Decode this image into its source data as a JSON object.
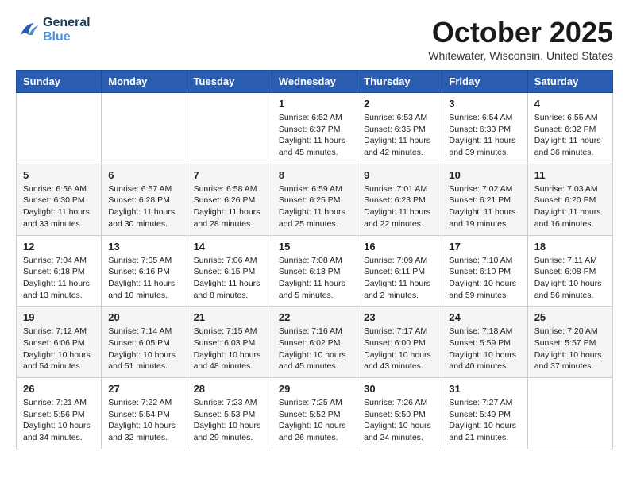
{
  "header": {
    "logo_line1": "General",
    "logo_line2": "Blue",
    "month": "October 2025",
    "location": "Whitewater, Wisconsin, United States"
  },
  "weekdays": [
    "Sunday",
    "Monday",
    "Tuesday",
    "Wednesday",
    "Thursday",
    "Friday",
    "Saturday"
  ],
  "weeks": [
    [
      {
        "day": "",
        "info": ""
      },
      {
        "day": "",
        "info": ""
      },
      {
        "day": "",
        "info": ""
      },
      {
        "day": "1",
        "info": "Sunrise: 6:52 AM\nSunset: 6:37 PM\nDaylight: 11 hours\nand 45 minutes."
      },
      {
        "day": "2",
        "info": "Sunrise: 6:53 AM\nSunset: 6:35 PM\nDaylight: 11 hours\nand 42 minutes."
      },
      {
        "day": "3",
        "info": "Sunrise: 6:54 AM\nSunset: 6:33 PM\nDaylight: 11 hours\nand 39 minutes."
      },
      {
        "day": "4",
        "info": "Sunrise: 6:55 AM\nSunset: 6:32 PM\nDaylight: 11 hours\nand 36 minutes."
      }
    ],
    [
      {
        "day": "5",
        "info": "Sunrise: 6:56 AM\nSunset: 6:30 PM\nDaylight: 11 hours\nand 33 minutes."
      },
      {
        "day": "6",
        "info": "Sunrise: 6:57 AM\nSunset: 6:28 PM\nDaylight: 11 hours\nand 30 minutes."
      },
      {
        "day": "7",
        "info": "Sunrise: 6:58 AM\nSunset: 6:26 PM\nDaylight: 11 hours\nand 28 minutes."
      },
      {
        "day": "8",
        "info": "Sunrise: 6:59 AM\nSunset: 6:25 PM\nDaylight: 11 hours\nand 25 minutes."
      },
      {
        "day": "9",
        "info": "Sunrise: 7:01 AM\nSunset: 6:23 PM\nDaylight: 11 hours\nand 22 minutes."
      },
      {
        "day": "10",
        "info": "Sunrise: 7:02 AM\nSunset: 6:21 PM\nDaylight: 11 hours\nand 19 minutes."
      },
      {
        "day": "11",
        "info": "Sunrise: 7:03 AM\nSunset: 6:20 PM\nDaylight: 11 hours\nand 16 minutes."
      }
    ],
    [
      {
        "day": "12",
        "info": "Sunrise: 7:04 AM\nSunset: 6:18 PM\nDaylight: 11 hours\nand 13 minutes."
      },
      {
        "day": "13",
        "info": "Sunrise: 7:05 AM\nSunset: 6:16 PM\nDaylight: 11 hours\nand 10 minutes."
      },
      {
        "day": "14",
        "info": "Sunrise: 7:06 AM\nSunset: 6:15 PM\nDaylight: 11 hours\nand 8 minutes."
      },
      {
        "day": "15",
        "info": "Sunrise: 7:08 AM\nSunset: 6:13 PM\nDaylight: 11 hours\nand 5 minutes."
      },
      {
        "day": "16",
        "info": "Sunrise: 7:09 AM\nSunset: 6:11 PM\nDaylight: 11 hours\nand 2 minutes."
      },
      {
        "day": "17",
        "info": "Sunrise: 7:10 AM\nSunset: 6:10 PM\nDaylight: 10 hours\nand 59 minutes."
      },
      {
        "day": "18",
        "info": "Sunrise: 7:11 AM\nSunset: 6:08 PM\nDaylight: 10 hours\nand 56 minutes."
      }
    ],
    [
      {
        "day": "19",
        "info": "Sunrise: 7:12 AM\nSunset: 6:06 PM\nDaylight: 10 hours\nand 54 minutes."
      },
      {
        "day": "20",
        "info": "Sunrise: 7:14 AM\nSunset: 6:05 PM\nDaylight: 10 hours\nand 51 minutes."
      },
      {
        "day": "21",
        "info": "Sunrise: 7:15 AM\nSunset: 6:03 PM\nDaylight: 10 hours\nand 48 minutes."
      },
      {
        "day": "22",
        "info": "Sunrise: 7:16 AM\nSunset: 6:02 PM\nDaylight: 10 hours\nand 45 minutes."
      },
      {
        "day": "23",
        "info": "Sunrise: 7:17 AM\nSunset: 6:00 PM\nDaylight: 10 hours\nand 43 minutes."
      },
      {
        "day": "24",
        "info": "Sunrise: 7:18 AM\nSunset: 5:59 PM\nDaylight: 10 hours\nand 40 minutes."
      },
      {
        "day": "25",
        "info": "Sunrise: 7:20 AM\nSunset: 5:57 PM\nDaylight: 10 hours\nand 37 minutes."
      }
    ],
    [
      {
        "day": "26",
        "info": "Sunrise: 7:21 AM\nSunset: 5:56 PM\nDaylight: 10 hours\nand 34 minutes."
      },
      {
        "day": "27",
        "info": "Sunrise: 7:22 AM\nSunset: 5:54 PM\nDaylight: 10 hours\nand 32 minutes."
      },
      {
        "day": "28",
        "info": "Sunrise: 7:23 AM\nSunset: 5:53 PM\nDaylight: 10 hours\nand 29 minutes."
      },
      {
        "day": "29",
        "info": "Sunrise: 7:25 AM\nSunset: 5:52 PM\nDaylight: 10 hours\nand 26 minutes."
      },
      {
        "day": "30",
        "info": "Sunrise: 7:26 AM\nSunset: 5:50 PM\nDaylight: 10 hours\nand 24 minutes."
      },
      {
        "day": "31",
        "info": "Sunrise: 7:27 AM\nSunset: 5:49 PM\nDaylight: 10 hours\nand 21 minutes."
      },
      {
        "day": "",
        "info": ""
      }
    ]
  ]
}
